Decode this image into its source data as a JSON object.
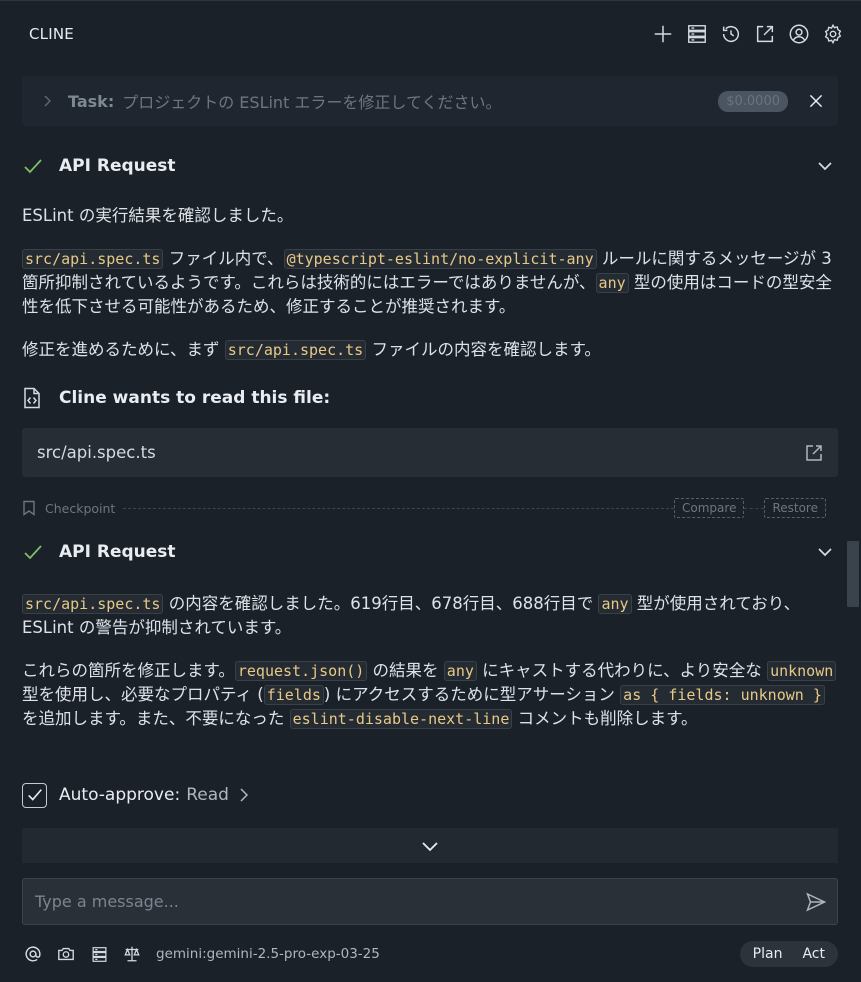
{
  "app": {
    "title": "CLINE"
  },
  "header_icons": [
    "plus-icon",
    "server-icon",
    "history-icon",
    "popout-icon",
    "account-icon",
    "gear-icon"
  ],
  "task": {
    "label": "Task:",
    "text": "プロジェクトの ESLint エラーを修正してください。",
    "cost": "$0.0000"
  },
  "request1": {
    "title": "API Request",
    "p1": "ESLint の実行結果を確認しました。",
    "p2": {
      "c1": "src/api.spec.ts",
      "t1": " ファイル内で、",
      "c2": "@typescript-eslint/no-explicit-any",
      "t2": " ルールに関するメッセージが 3 箇所抑制されているようです。これらは技術的にはエラーではありませんが、",
      "c3": "any",
      "t3": " 型の使用はコードの型安全性を低下させる可能性があるため、修正することが推奨されます。"
    },
    "p3": {
      "t1": "修正を進めるために、まず ",
      "c1": "src/api.spec.ts",
      "t2": " ファイルの内容を確認します。"
    }
  },
  "read_file": {
    "title": "Cline wants to read this file:",
    "path": "src/api.spec.ts"
  },
  "checkpoint": {
    "label": "Checkpoint",
    "compare": "Compare",
    "restore": "Restore"
  },
  "request2": {
    "title": "API Request",
    "p1": {
      "c1": "src/api.spec.ts",
      "t1": " の内容を確認しました。619行目、678行目、688行目で ",
      "c2": "any",
      "t2": " 型が使用されており、ESLint の警告が抑制されています。"
    },
    "p2": {
      "t1": "これらの箇所を修正します。",
      "c1": "request.json()",
      "t2": " の結果を ",
      "c2": "any",
      "t3": " にキャストする代わりに、より安全な ",
      "c3": "unknown",
      "t4": " 型を使用し、必要なプロパティ (",
      "c4": "fields",
      "t5": ") にアクセスするために型アサーション ",
      "c5": "as { fields: unknown }",
      "t6": " を追加します。また、不要になった ",
      "c6": "eslint-disable-next-line",
      "t7": " コメントも削除します。"
    }
  },
  "auto_approve": {
    "label": "Auto-approve:",
    "value": "Read"
  },
  "input": {
    "placeholder": "Type a message..."
  },
  "footer": {
    "model": "gemini:gemini-2.5-pro-exp-03-25",
    "plan": "Plan",
    "act": "Act"
  }
}
